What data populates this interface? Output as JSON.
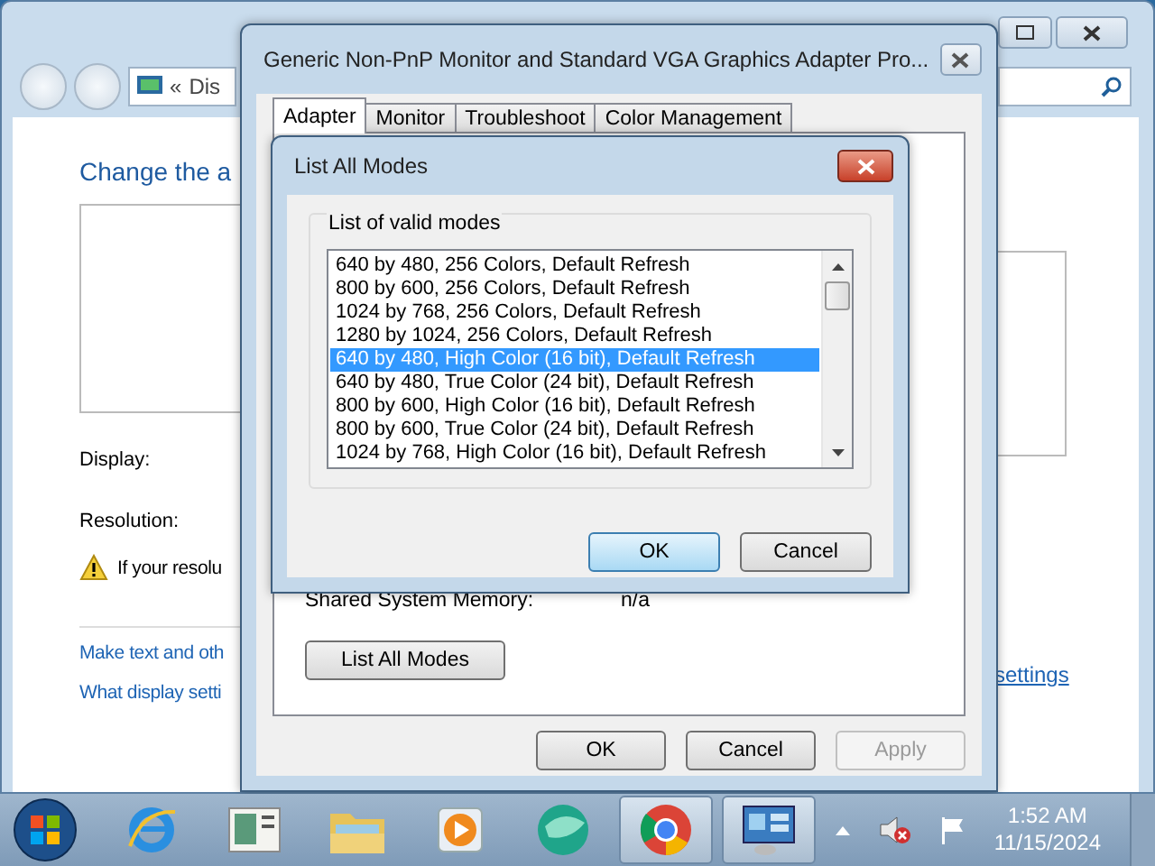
{
  "control_panel": {
    "address": {
      "prefix": "«",
      "text": "Dis"
    },
    "heading": "Change the a",
    "display_label": "Display:",
    "resolution_label": "Resolution:",
    "warning": "If your resolu",
    "links": [
      "Make text and oth",
      "What display setti"
    ],
    "right_link": "settings"
  },
  "properties": {
    "title": "Generic Non-PnP Monitor and Standard VGA Graphics Adapter Pro...",
    "tabs": [
      {
        "label": "Adapter",
        "selected": true
      },
      {
        "label": "Monitor",
        "selected": false
      },
      {
        "label": "Troubleshoot",
        "selected": false
      },
      {
        "label": "Color Management",
        "selected": false
      }
    ],
    "shared_memory": {
      "label": "Shared System Memory:",
      "value": "n/a"
    },
    "list_button": "List All Modes",
    "buttons": [
      {
        "label": "OK",
        "disabled": false
      },
      {
        "label": "Cancel",
        "disabled": false
      },
      {
        "label": "Apply",
        "disabled": true
      }
    ]
  },
  "modes_dialog": {
    "title": "List All Modes",
    "group": "List of valid modes",
    "modes": [
      {
        "label": "640 by 480, 256 Colors, Default Refresh",
        "selected": false
      },
      {
        "label": "800 by 600, 256 Colors, Default Refresh",
        "selected": false
      },
      {
        "label": "1024 by 768, 256 Colors, Default Refresh",
        "selected": false
      },
      {
        "label": "1280 by 1024, 256 Colors, Default Refresh",
        "selected": false
      },
      {
        "label": "640 by 480, High Color (16 bit), Default Refresh",
        "selected": true
      },
      {
        "label": "640 by 480, True Color (24 bit), Default Refresh",
        "selected": false
      },
      {
        "label": "800 by 600, High Color (16 bit), Default Refresh",
        "selected": false
      },
      {
        "label": "800 by 600, True Color (24 bit), Default Refresh",
        "selected": false
      },
      {
        "label": "1024 by 768, High Color (16 bit), Default Refresh",
        "selected": false
      }
    ],
    "buttons": [
      {
        "label": "OK",
        "default": true
      },
      {
        "label": "Cancel",
        "default": false
      }
    ]
  },
  "taskbar": {
    "apps": [
      {
        "kind": "ie",
        "active": false
      },
      {
        "kind": "document",
        "active": false
      },
      {
        "kind": "folder",
        "active": false
      },
      {
        "kind": "media",
        "active": false
      },
      {
        "kind": "sphere",
        "active": false
      },
      {
        "kind": "chrome",
        "active": true
      },
      {
        "kind": "display",
        "active": true
      }
    ],
    "clock": {
      "time": "1:52 AM",
      "date": "11/15/2024"
    }
  }
}
